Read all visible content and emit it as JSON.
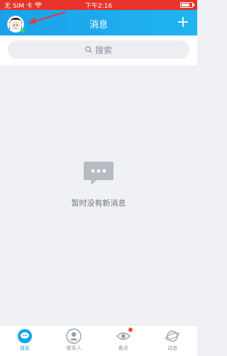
{
  "status_bar": {
    "carrier": "无 SIM 卡",
    "time": "下午2:16",
    "battery_level": 0.8
  },
  "nav": {
    "title": "消息"
  },
  "search": {
    "placeholder": "搜索"
  },
  "empty_state": {
    "message": "暂时没有新消息"
  },
  "tabs": [
    {
      "label": "消息",
      "icon": "message-icon",
      "active": true
    },
    {
      "label": "联系人",
      "icon": "contacts-icon",
      "active": false
    },
    {
      "label": "看点",
      "icon": "eye-icon",
      "active": false,
      "badge": true
    },
    {
      "label": "动态",
      "icon": "planet-icon",
      "active": false
    }
  ],
  "colors": {
    "status_bar": "#e8332a",
    "nav_bar": "#1aa1ea",
    "accent": "#12a4ee",
    "badge": "#f0462f",
    "annotation_arrow": "#e53a2c"
  }
}
